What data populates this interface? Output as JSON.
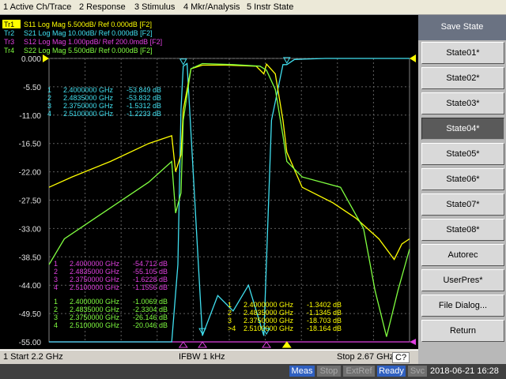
{
  "menubar": {
    "items": [
      "1 Active Ch/Trace",
      "2 Response",
      "3 Stimulus",
      "4 Mkr/Analysis",
      "5 Instr State"
    ]
  },
  "screen": {
    "trace_headers": [
      {
        "tr": "Tr1",
        "text": "S11  Log Mag 5.500dB/ Ref 0.000dB [F2]",
        "color": "#ffff00"
      },
      {
        "tr": "Tr2",
        "text": "S21  Log Mag 10.00dB/ Ref 0.000dB [F2]",
        "color": "#40e0f0"
      },
      {
        "tr": "Tr3",
        "text": "S12  Log Mag 1.000pdB/ Ref 200.0mdB [F2]",
        "color": "#e040e0"
      },
      {
        "tr": "Tr4",
        "text": "S22  Log Mag 5.500dB/ Ref 0.000dB [F2]",
        "color": "#80ff40"
      }
    ],
    "y_labels": [
      "0.000",
      "-5.50",
      "-11.00",
      "-16.50",
      "-22.00",
      "-27.50",
      "-33.00",
      "-38.50",
      "-44.00",
      "-49.50",
      "-55.00"
    ],
    "marker_tables": [
      {
        "color": "#40e0f0",
        "rows": [
          {
            "id": "1",
            "freq": "2.4000000 GHz",
            "val": "-53.849 dB"
          },
          {
            "id": "2",
            "freq": "2.4835000 GHz",
            "val": "-53.832 dB"
          },
          {
            "id": "3",
            "freq": "2.3750000 GHz",
            "val": "-1.5312 dB"
          },
          {
            "id": "4",
            "freq": "2.5100000 GHz",
            "val": "-1.2233 dB"
          }
        ]
      },
      {
        "color": "#e040e0",
        "rows": [
          {
            "id": "1",
            "freq": "2.4000000 GHz",
            "val": "-54.712 dB"
          },
          {
            "id": "2",
            "freq": "2.4835000 GHz",
            "val": "-55.105 dB"
          },
          {
            "id": "3",
            "freq": "2.3750000 GHz",
            "val": "-1.6228 dB"
          },
          {
            "id": "4",
            "freq": "2.5100000 GHz",
            "val": "-1.1556 dB"
          }
        ]
      },
      {
        "color": "#80ff40",
        "rows": [
          {
            "id": "1",
            "freq": "2.4000000 GHz",
            "val": "-1.0069 dB"
          },
          {
            "id": "2",
            "freq": "2.4835000 GHz",
            "val": "-2.3304 dB"
          },
          {
            "id": "3",
            "freq": "2.3750000 GHz",
            "val": "-26.146 dB"
          },
          {
            "id": "4",
            "freq": "2.5100000 GHz",
            "val": "-20.046 dB"
          }
        ]
      },
      {
        "color": "#ffff00",
        "rows": [
          {
            "id": "1",
            "freq": "2.4000000 GHz",
            "val": "-1.3402 dB"
          },
          {
            "id": "2",
            "freq": "2.4835000 GHz",
            "val": "-1.1345 dB"
          },
          {
            "id": "3",
            "freq": "2.3750000 GHz",
            "val": "-18.703 dB"
          },
          {
            "id": ">4",
            "freq": "2.5100000 GHz",
            "val": "-18.164 dB"
          }
        ]
      }
    ]
  },
  "chart_data": {
    "type": "line",
    "xlim": [
      2.2,
      2.67
    ],
    "ylim": [
      -55,
      0
    ],
    "yticks": [
      0,
      -5.5,
      -11,
      -16.5,
      -22,
      -27.5,
      -33,
      -38.5,
      -44,
      -49.5,
      -55
    ],
    "grid": true,
    "series": [
      {
        "name": "S21",
        "color": "#40e0f0",
        "x": [
          2.2,
          2.36,
          2.368,
          2.372,
          2.375,
          2.38,
          2.4,
          2.42,
          2.44,
          2.46,
          2.48,
          2.49,
          2.505,
          2.51,
          2.52,
          2.56,
          2.6,
          2.64,
          2.67
        ],
        "y": [
          -55,
          -55,
          -40,
          -10,
          -1.5,
          -1.0,
          -53.8,
          -46,
          -49,
          -44,
          -53.8,
          -12,
          -1.2,
          -1.2,
          -0.2,
          0,
          0,
          0,
          0
        ]
      },
      {
        "name": "S11",
        "color": "#ffff00",
        "x": [
          2.2,
          2.23,
          2.28,
          2.33,
          2.36,
          2.365,
          2.372,
          2.375,
          2.385,
          2.4,
          2.43,
          2.47,
          2.48,
          2.4835,
          2.495,
          2.505,
          2.51,
          2.53,
          2.57,
          2.6,
          2.63,
          2.65,
          2.66,
          2.67
        ],
        "y": [
          -25,
          -23,
          -20,
          -16.5,
          -15,
          -22,
          -18.7,
          -10,
          -2.0,
          -1.3,
          -1.3,
          -1.5,
          -3,
          -1.1,
          -3,
          -12,
          -18.2,
          -25,
          -28,
          -31,
          -35,
          -39,
          -36,
          -35
        ]
      },
      {
        "name": "S22",
        "color": "#80ff40",
        "x": [
          2.2,
          2.22,
          2.27,
          2.33,
          2.36,
          2.365,
          2.372,
          2.375,
          2.385,
          2.4,
          2.44,
          2.475,
          2.4835,
          2.495,
          2.505,
          2.51,
          2.53,
          2.58,
          2.61,
          2.625,
          2.64,
          2.655,
          2.67
        ],
        "y": [
          -40,
          -35,
          -30,
          -24,
          -20,
          -30,
          -26.1,
          -12,
          -2,
          -1.0,
          -1.2,
          -1.5,
          -2.3,
          -6,
          -15,
          -20.0,
          -23,
          -25,
          -33,
          -45,
          -54,
          -45,
          -37
        ]
      },
      {
        "name": "S12",
        "color": "#e040e0",
        "x": [
          2.2,
          2.67
        ],
        "y": [
          -55,
          -55
        ]
      }
    ]
  },
  "statusbar": {
    "start": "1  Start 2.2 GHz",
    "ifbw": "IFBW 1 kHz",
    "stop": "Stop 2.67 GHz",
    "badge": "C?"
  },
  "bottombar": {
    "meas": "Meas",
    "stop": "Stop",
    "extref": "ExtRef",
    "ready": "Ready",
    "svc": "Svc",
    "datetime": "2018-06-21 16:28"
  },
  "sidepanel": {
    "header": "Save State",
    "buttons": [
      "State01*",
      "State02*",
      "State03*",
      "State04*",
      "State05*",
      "State06*",
      "State07*",
      "State08*",
      "Autorec",
      "UserPres*",
      "File Dialog...",
      "Return"
    ],
    "active_index": 3
  }
}
